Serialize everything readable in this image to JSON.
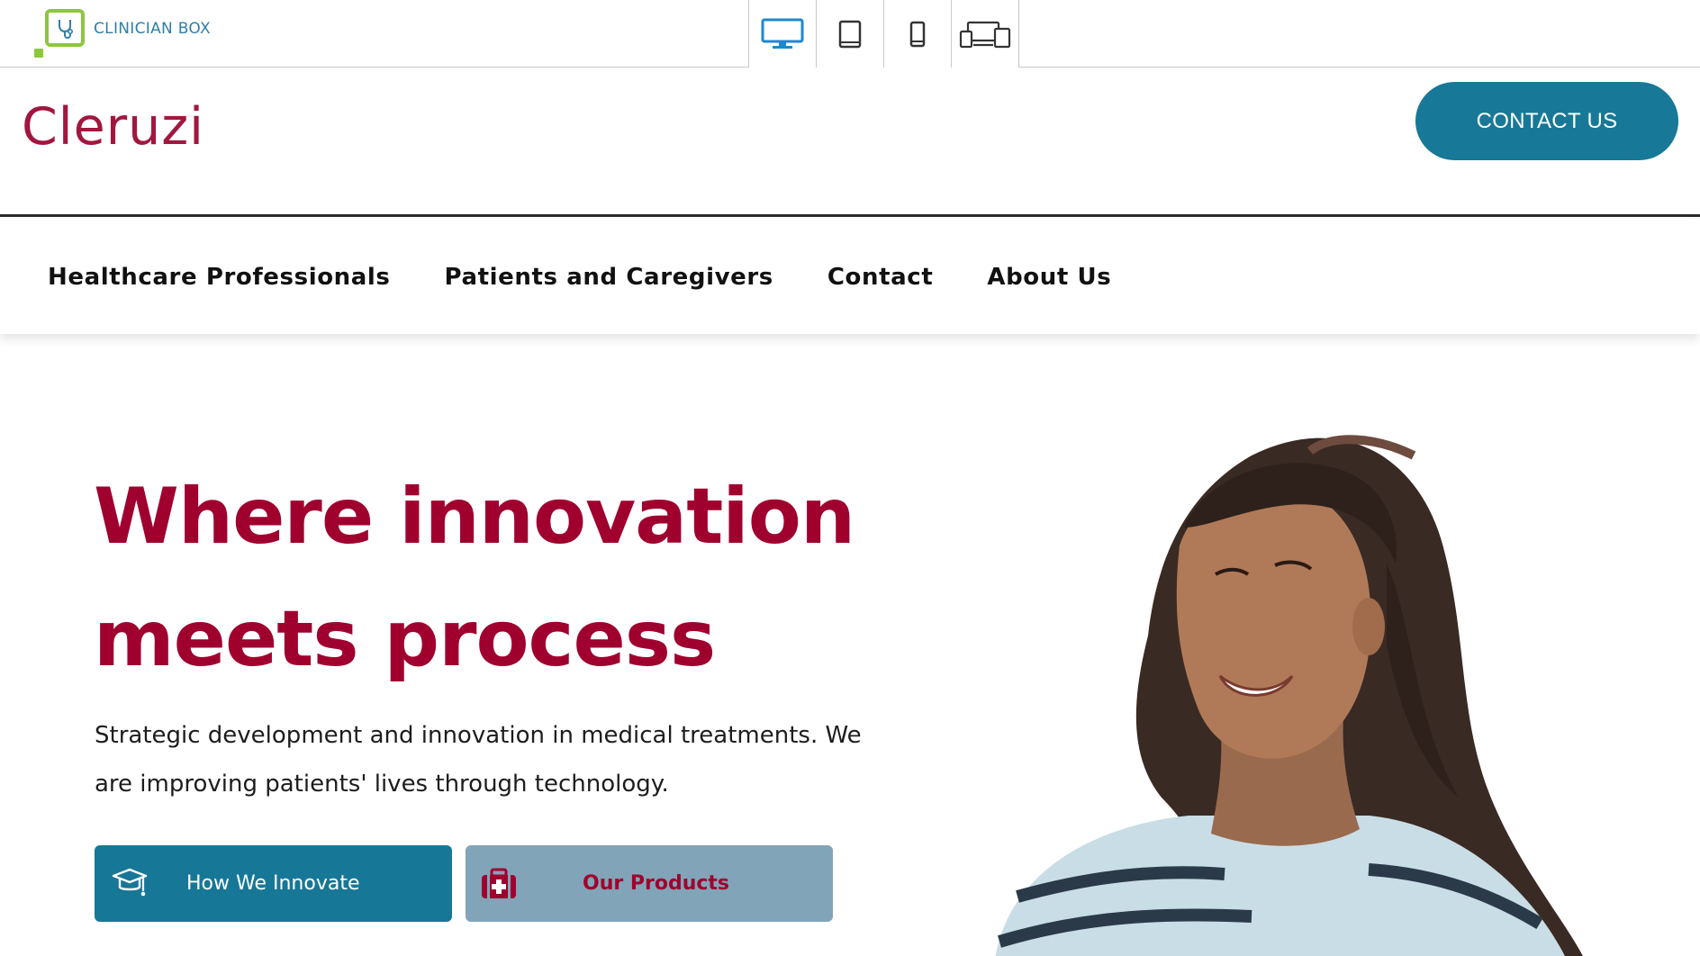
{
  "toolbar": {
    "brand_text": "CLINICIAN BOX",
    "devices": [
      {
        "name": "desktop",
        "icon": "desktop-icon",
        "active": true
      },
      {
        "name": "tablet",
        "icon": "tablet-icon",
        "active": false
      },
      {
        "name": "mobile",
        "icon": "mobile-icon",
        "active": false
      },
      {
        "name": "all-devices",
        "icon": "multi-device-icon",
        "active": false
      }
    ]
  },
  "header": {
    "brand": "Cleruzi",
    "contact_label": "CONTACT US"
  },
  "nav": {
    "items": [
      {
        "label": "Healthcare Professionals"
      },
      {
        "label": "Patients and Caregivers"
      },
      {
        "label": "Contact"
      },
      {
        "label": "About Us"
      }
    ]
  },
  "hero": {
    "title_line1": "Where innovation",
    "title_line2": "meets process",
    "subtitle": "Strategic development and innovation in medical treatments. We are improving patients' lives through technology.",
    "primary_button": {
      "label": "How We Innovate",
      "icon": "graduation-cap-icon"
    },
    "secondary_button": {
      "label": "Our Products",
      "icon": "medical-kit-icon"
    }
  },
  "colors": {
    "brand_maroon": "#a0002e",
    "teal": "#187897",
    "muted_blue": "#82a4b8",
    "clinician_green": "#8dc63f",
    "clinician_blue": "#2e7fa6"
  }
}
